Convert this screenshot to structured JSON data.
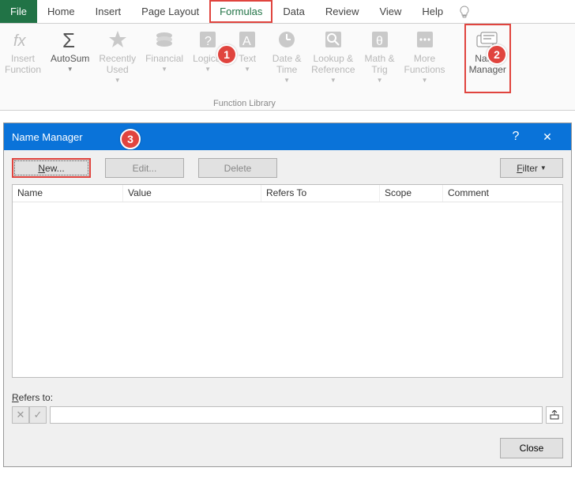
{
  "tabs": {
    "file": "File",
    "home": "Home",
    "insert": "Insert",
    "page_layout": "Page Layout",
    "formulas": "Formulas",
    "data": "Data",
    "review": "Review",
    "view": "View",
    "help": "Help"
  },
  "ribbon": {
    "insert_function": "Insert\nFunction",
    "autosum": "AutoSum",
    "recently_used": "Recently\nUsed",
    "financial": "Financial",
    "logical": "Logical",
    "text": "Text",
    "date_time": "Date &\nTime",
    "lookup_ref": "Lookup &\nReference",
    "math_trig": "Math &\nTrig",
    "more_functions": "More\nFunctions",
    "name_manager": "Name\nManager",
    "group_title": "Function Library"
  },
  "callouts": {
    "one": "1",
    "two": "2",
    "three": "3"
  },
  "dialog": {
    "title": "Name Manager",
    "help": "?",
    "close_x": "✕",
    "new": "New...",
    "new_u": "N",
    "edit": "Edit...",
    "delete": "Delete",
    "filter": "ilter",
    "filter_u": "F",
    "cols": {
      "name": "Name",
      "value": "Value",
      "refers": "Refers To",
      "scope": "Scope",
      "comment": "Comment"
    },
    "refers_label_u": "R",
    "refers_label": "efers to:",
    "close": "Close"
  }
}
